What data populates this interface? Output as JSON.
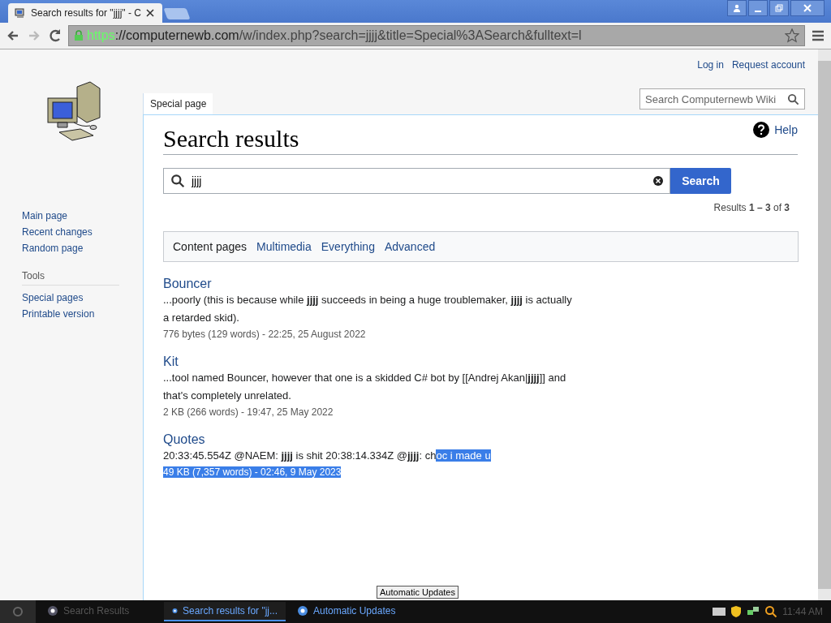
{
  "browser": {
    "tabs": [
      {
        "title": "Search results for \"jjjj\" - C",
        "selected": true
      }
    ],
    "url_scheme": "https",
    "url_host": "://computernewb.com",
    "url_rest": "/w/index.php?search=jjjj&title=Special%3ASearch&fulltext=l"
  },
  "personal": [
    "Log in",
    "Request account"
  ],
  "sidebar": {
    "nav": [
      "Main page",
      "Recent changes",
      "Random page"
    ],
    "tools_heading": "Tools",
    "tools": [
      "Special pages",
      "Printable version"
    ]
  },
  "page_tab": "Special page",
  "wiki_search": {
    "placeholder": "Search Computernewb Wiki"
  },
  "title": "Search results",
  "help": "Help",
  "search": {
    "value": "jjjj",
    "button": "Search"
  },
  "results_count": "Results **1 – 3** of **3**",
  "profiles": [
    {
      "label": "Content pages",
      "selected": true
    },
    {
      "label": "Multimedia",
      "selected": false
    },
    {
      "label": "Everything",
      "selected": false
    },
    {
      "label": "Advanced",
      "selected": false
    }
  ],
  "results": [
    {
      "title": "Bouncer",
      "snippet": [
        {
          "text": "...poorly (this is because while **jjjj** succeeds in being a huge troublemaker, **jjjj** is actually a retarded skid).",
          "selected": false
        }
      ],
      "meta": "776 bytes (129 words) - 22:25, 25 August 2022",
      "meta_selected": false
    },
    {
      "title": "Kit",
      "snippet": [
        {
          "text": "...tool named Bouncer, however that one is a skidded C# bot by [[Andrej Akan|**jjjj**]] and that's completely unrelated.",
          "selected": false
        }
      ],
      "meta": "2 KB (266 words) - 19:47, 25 May 2022",
      "meta_selected": false
    },
    {
      "title": "Quotes",
      "snippet": [
        {
          "text": "20:33:45.554Z @NAEM: **jjjj** is shit 20:38:14.334Z @**jjjj**: ch",
          "selected": false
        },
        {
          "text": "oc i made u ",
          "selected": true
        }
      ],
      "meta": "49 KB (7,357 words) - 02:46, 9 May 2023",
      "meta_selected": true
    }
  ],
  "tooltip": "Automatic Updates",
  "taskbar": {
    "items": [
      {
        "label": "Search Results",
        "selected": false,
        "disabled": true
      },
      {
        "label": "Search results for \"jj...",
        "selected": true,
        "disabled": false
      },
      {
        "label": "Automatic Updates",
        "selected": false,
        "disabled": false
      }
    ],
    "clock": "11:44 AM"
  }
}
